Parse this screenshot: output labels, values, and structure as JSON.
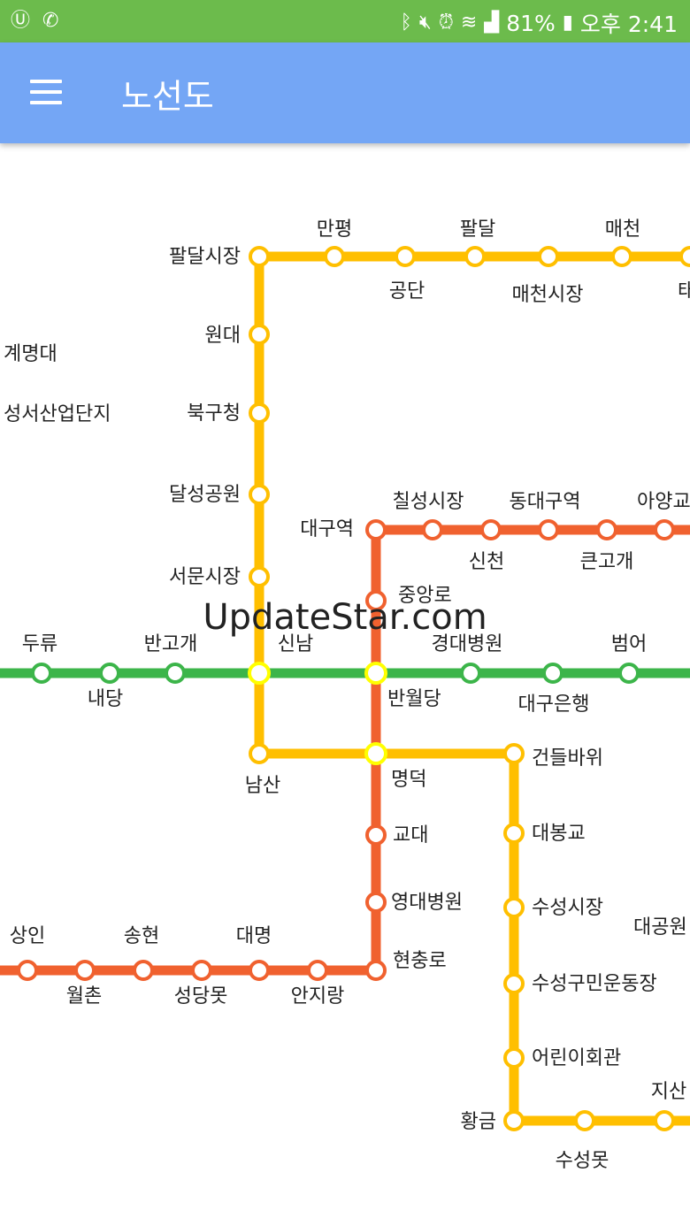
{
  "status_bar": {
    "battery": "81%",
    "time": "오후 2:41",
    "icons": [
      "u-plus-icon",
      "phone-icon",
      "bluetooth-icon",
      "mute-icon",
      "alarm-icon",
      "wifi-icon",
      "signal-icon",
      "battery-icon"
    ]
  },
  "app_bar": {
    "title": "노선도",
    "menu_icon": "hamburger-menu-icon"
  },
  "watermark": "UpdateStar.com",
  "colors": {
    "line1": "#f0612f",
    "line2": "#3cb54a",
    "line3": "#ffbf00",
    "transfer": "#ffff00",
    "statusbar": "#6cbb4c",
    "appbar": "#74a6f5"
  },
  "stations": {
    "s_mangpyeong": "만평",
    "s_paldal": "팔달",
    "s_maecheon": "매천",
    "s_paldal_market": "팔달시장",
    "s_gongdan": "공단",
    "s_maecheon_market": "매천시장",
    "s_ta": "태",
    "s_gyemyeong": "계명대",
    "s_wondae": "원대",
    "s_seongseo": "성서산업단지",
    "s_bukgu": "북구청",
    "s_dalseong": "달성공원",
    "s_chilseong": "칠성시장",
    "s_dongdaegu": "동대구역",
    "s_ayang": "아양교",
    "s_daegu": "대구역",
    "s_sincheon": "신천",
    "s_keungogae": "큰고개",
    "s_seomun": "서문시장",
    "s_jungang": "중앙로",
    "s_duryu": "두류",
    "s_bangogae": "반고개",
    "s_sinnam": "신남",
    "s_gyeongdae": "경대병원",
    "s_beomeo": "범어",
    "s_naedang": "내당",
    "s_banwoldang": "반월당",
    "s_daegubank": "대구은행",
    "s_geondeul": "건들바위",
    "s_namsan": "남산",
    "s_myeongdeok": "명덕",
    "s_gyodae": "교대",
    "s_daebong": "대봉교",
    "s_yeongdae": "영대병원",
    "s_suseong_market": "수성시장",
    "s_daegong": "대공원",
    "s_sangin": "상인",
    "s_songhyeon": "송현",
    "s_daemyeong": "대명",
    "s_hyeonchung": "현충로",
    "s_wolchon": "월촌",
    "s_seongdangmot": "성당못",
    "s_anjirang": "안지랑",
    "s_suseonggu": "수성구민운동장",
    "s_eorini": "어린이회관",
    "s_jisan": "지산",
    "s_hwanggeum": "황금",
    "s_suseongmot": "수성못"
  }
}
